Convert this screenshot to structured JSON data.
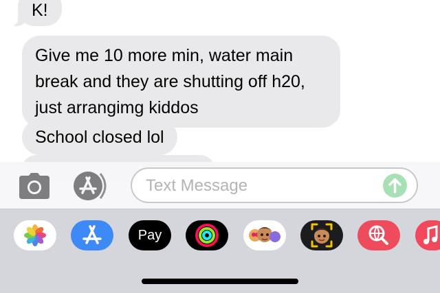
{
  "messages": [
    {
      "text": "K!",
      "from": "them"
    },
    {
      "text": "Give me 10 more min, water main break and they are shutting off h20, just arrangimg kiddos",
      "from": "them"
    },
    {
      "text": "School closed lol",
      "from": "them"
    }
  ],
  "compose": {
    "placeholder": "Text Message"
  },
  "app_drawer": {
    "apps": [
      {
        "name": "Photos",
        "icon": "photos-icon"
      },
      {
        "name": "App Store",
        "icon": "app-store-icon"
      },
      {
        "name": "Apple Pay",
        "icon": "apple-pay-icon",
        "label": "Pay"
      },
      {
        "name": "Fitness",
        "icon": "fitness-rings-icon"
      },
      {
        "name": "Memoji Stickers",
        "icon": "memoji-stickers-icon"
      },
      {
        "name": "Animoji",
        "icon": "animoji-icon"
      },
      {
        "name": "Image Search",
        "icon": "globe-search-icon"
      },
      {
        "name": "Music",
        "icon": "music-icon"
      }
    ]
  },
  "colors": {
    "incoming_bubble": "#e9e9eb",
    "send_button": "#a8e0b5",
    "drawer_background": "#d4d6dc"
  }
}
